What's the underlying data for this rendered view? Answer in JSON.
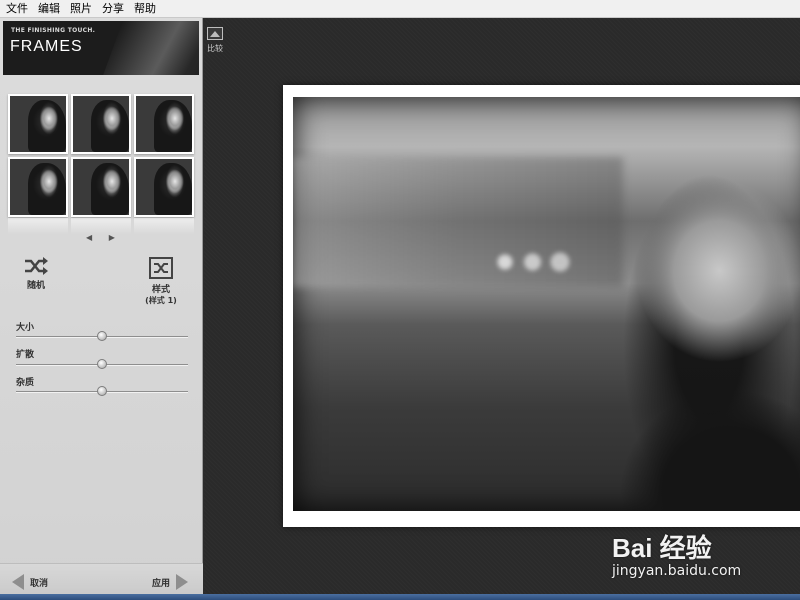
{
  "menu": {
    "items": [
      "文件",
      "编辑",
      "照片",
      "分享",
      "帮助"
    ]
  },
  "header": {
    "tagline": "THE FINISHING TOUCH.",
    "title": "FRAMES"
  },
  "thumbnails": {
    "count": 6
  },
  "actions": {
    "random_label": "随机",
    "style_label": "样式",
    "style_value": "(样式 1)"
  },
  "sliders": [
    {
      "label": "大小",
      "value": 0.5
    },
    {
      "label": "扩散",
      "value": 0.5
    },
    {
      "label": "杂质",
      "value": 0.5
    }
  ],
  "bottom": {
    "cancel_label": "取消",
    "apply_label": "应用"
  },
  "canvas": {
    "compare_label": "比较"
  },
  "watermark": {
    "logo": "Bai 经验",
    "url": "jingyan.baidu.com"
  },
  "icons": [
    "shuffle-icon",
    "style-icon",
    "compare-icon",
    "prev-arrow-icon",
    "next-arrow-icon"
  ]
}
